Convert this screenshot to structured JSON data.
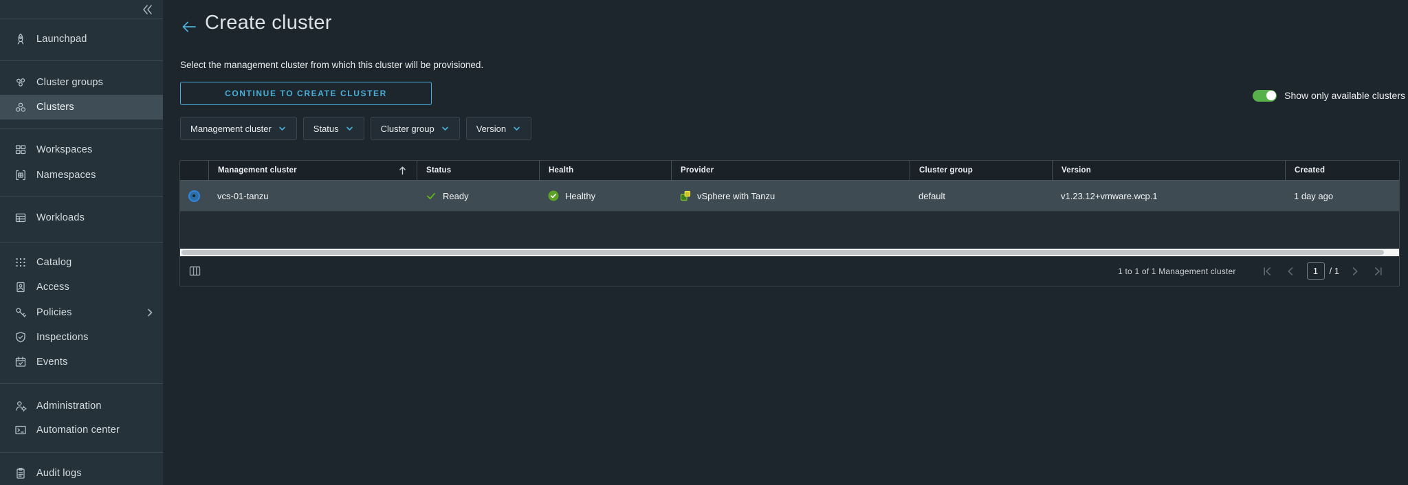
{
  "sidebar": {
    "collapse_icon": "double-chevron-left",
    "items": [
      {
        "label": "Launchpad",
        "icon": "rocket"
      },
      {
        "label": "Cluster groups",
        "icon": "cluster-groups"
      },
      {
        "label": "Clusters",
        "icon": "clusters",
        "selected": true
      },
      {
        "label": "Workspaces",
        "icon": "workspaces"
      },
      {
        "label": "Namespaces",
        "icon": "namespaces"
      },
      {
        "label": "Workloads",
        "icon": "workloads"
      },
      {
        "label": "Catalog",
        "icon": "catalog"
      },
      {
        "label": "Access",
        "icon": "id-badge"
      },
      {
        "label": "Policies",
        "icon": "key",
        "has_submenu": true
      },
      {
        "label": "Inspections",
        "icon": "shield-check"
      },
      {
        "label": "Events",
        "icon": "calendar-check"
      },
      {
        "label": "Administration",
        "icon": "user-gear"
      },
      {
        "label": "Automation center",
        "icon": "terminal"
      },
      {
        "label": "Audit logs",
        "icon": "clipboard"
      }
    ]
  },
  "header": {
    "title": "Create cluster",
    "back_icon": "arrow-left"
  },
  "main": {
    "description": "Select the management cluster from which this cluster will be provisioned.",
    "continue_button": "CONTINUE TO CREATE CLUSTER",
    "toggle_label": "Show only available clusters",
    "toggle_on": true,
    "filters": [
      {
        "label": "Management cluster"
      },
      {
        "label": "Status"
      },
      {
        "label": "Cluster group"
      },
      {
        "label": "Version"
      }
    ]
  },
  "table": {
    "columns": [
      "Management cluster",
      "Status",
      "Health",
      "Provider",
      "Cluster group",
      "Version",
      "Created"
    ],
    "sorted_column": "Management cluster",
    "sort_direction": "asc",
    "rows": [
      {
        "selected": true,
        "management_cluster": "vcs-01-tanzu",
        "status": "Ready",
        "health": "Healthy",
        "provider": "vSphere with Tanzu",
        "cluster_group": "default",
        "version": "v1.23.12+vmware.wcp.1",
        "created": "1 day ago"
      }
    ],
    "footer": {
      "summary": "1 to 1 of 1 Management cluster",
      "page": "1",
      "pages": "/ 1"
    }
  },
  "colors": {
    "accent_blue": "#49afd9",
    "status_green": "#60b515",
    "healthy_badge_green": "#5ca324",
    "toggle_green": "#57b04a",
    "provider_green": "#4f9e2f",
    "provider_yellow": "#d9d133",
    "selected_row_bg": "#3e4b53",
    "sidebar_bg": "#26323a",
    "main_bg": "#1d262c"
  }
}
